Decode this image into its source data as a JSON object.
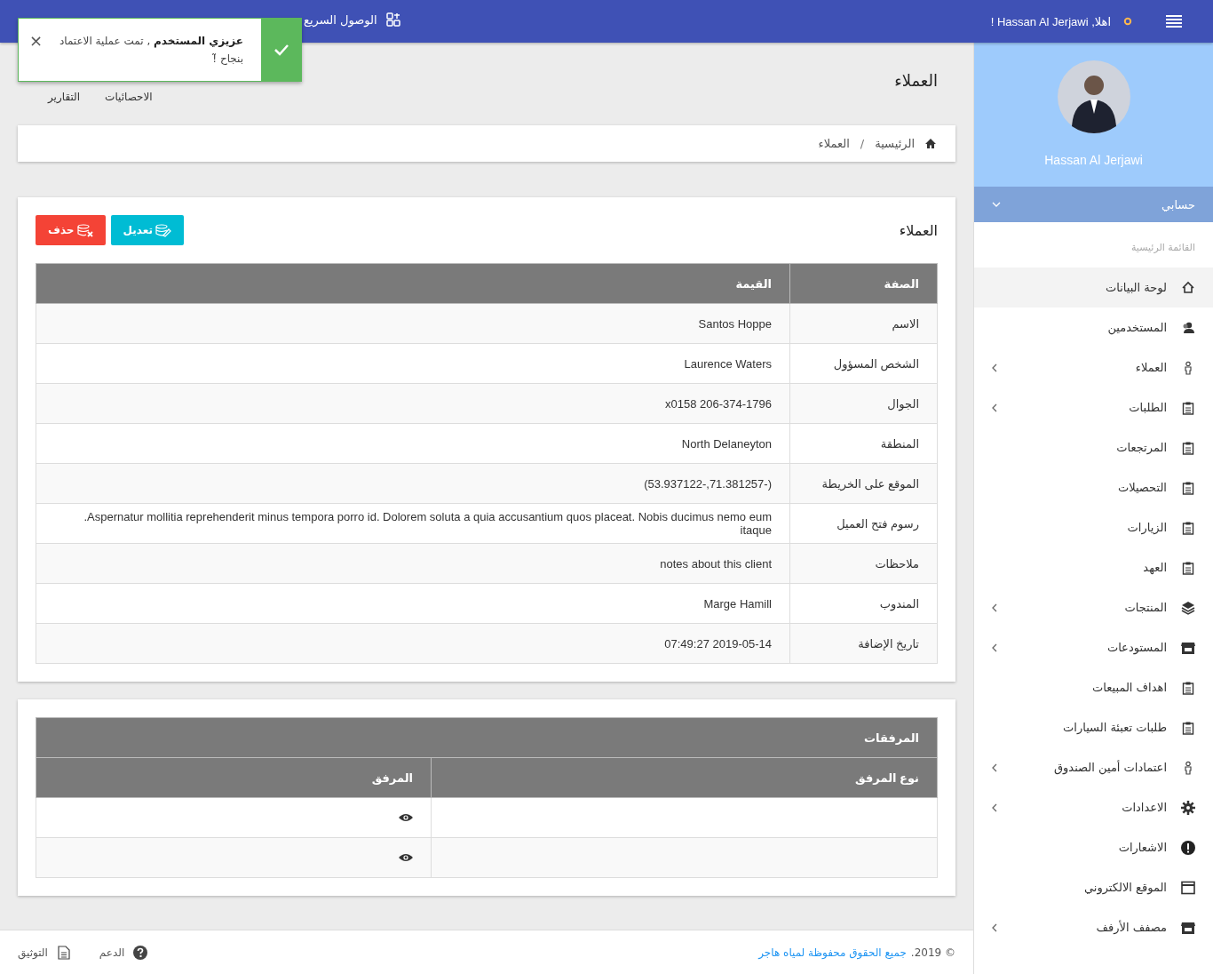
{
  "header": {
    "greeting": "اهلا, Hassan Al Jerjawi !",
    "quick_access": "الوصول السريع"
  },
  "toast": {
    "message": "**عزيزي المستخدم** , تمت عملية الاعتماد بنجاح ̃!",
    "close": "×"
  },
  "sidebar": {
    "user_name": "Hassan Al Jerjawi",
    "account": "حسابي",
    "section": "القائمة الرئيسية",
    "items": [
      {
        "label": "لوحة البيانات",
        "kind": "home",
        "selected": true,
        "submenu": false
      },
      {
        "label": "المستخدمين",
        "kind": "users",
        "selected": false,
        "submenu": false
      },
      {
        "label": "العملاء",
        "kind": "person",
        "selected": false,
        "submenu": true
      },
      {
        "label": "الطلبات",
        "kind": "clipboard",
        "selected": false,
        "submenu": true
      },
      {
        "label": "المرتجعات",
        "kind": "clipboard",
        "selected": false,
        "submenu": false
      },
      {
        "label": "التحصيلات",
        "kind": "clipboard",
        "selected": false,
        "submenu": false
      },
      {
        "label": "الزيارات",
        "kind": "clipboard",
        "selected": false,
        "submenu": false
      },
      {
        "label": "العهد",
        "kind": "clipboard",
        "selected": false,
        "submenu": false
      },
      {
        "label": "المنتجات",
        "kind": "layers",
        "selected": false,
        "submenu": true
      },
      {
        "label": "المستودعات",
        "kind": "store",
        "selected": false,
        "submenu": true
      },
      {
        "label": "اهداف المبيعات",
        "kind": "clipboard",
        "selected": false,
        "submenu": false
      },
      {
        "label": "طلبات تعبئة السيارات",
        "kind": "clipboard",
        "selected": false,
        "submenu": false
      },
      {
        "label": "اعتمادات أمين الصندوق",
        "kind": "person",
        "selected": false,
        "submenu": true
      },
      {
        "label": "الاعدادات",
        "kind": "gear",
        "selected": false,
        "submenu": true
      },
      {
        "label": "الاشعارات",
        "kind": "alert",
        "selected": false,
        "submenu": false
      },
      {
        "label": "الموقع الالكتروني",
        "kind": "browser",
        "selected": false,
        "submenu": false
      },
      {
        "label": "مصفف الأرفف",
        "kind": "store",
        "selected": false,
        "submenu": true
      }
    ]
  },
  "page": {
    "title": "العملاء",
    "tabs": [
      "الاحصائيات",
      "التقارير"
    ],
    "breadcrumb": {
      "home": "الرئيسية",
      "separator": "/",
      "current": "العملاء"
    }
  },
  "details": {
    "title": "العملاء",
    "buttons": [
      {
        "kind": "edit",
        "label": "تعديل"
      },
      {
        "kind": "delete",
        "label": "حذف"
      }
    ],
    "columns": [
      "الصفة",
      "القيمة"
    ],
    "rows": [
      [
        "الاسم",
        "Santos Hoppe"
      ],
      [
        "الشخص المسؤول",
        "Laurence Waters"
      ],
      [
        "الجوال",
        "x0158 206-374-1796"
      ],
      [
        "المنطقة",
        "North Delaneyton"
      ],
      [
        "الموقع على الخريطة",
        "(53.937122-,71.381257-)"
      ],
      [
        "رسوم فتح العميل",
        ".Aspernatur mollitia reprehenderit minus tempora porro id. Dolorem soluta a quia accusantium quos placeat. Nobis ducimus nemo eum itaque"
      ],
      [
        "ملاحظات",
        "notes about this client"
      ],
      [
        "المندوب",
        "Marge Hamill"
      ],
      [
        "تاريخ الإضافة",
        "07:49:27 2019-05-14"
      ]
    ]
  },
  "attachments": {
    "title": "المرفقات",
    "columns": [
      "نوع المرفق",
      "المرفق"
    ],
    "rows": [
      {
        "viewable": true
      },
      {
        "viewable": true
      }
    ]
  },
  "footer": {
    "copyright": "© 2019.",
    "owner": "جميع الحقوق محفوظة لمياه هاجر",
    "links": [
      {
        "kind": "help",
        "label": "الدعم"
      },
      {
        "kind": "doc",
        "label": "التوثيق"
      }
    ]
  }
}
